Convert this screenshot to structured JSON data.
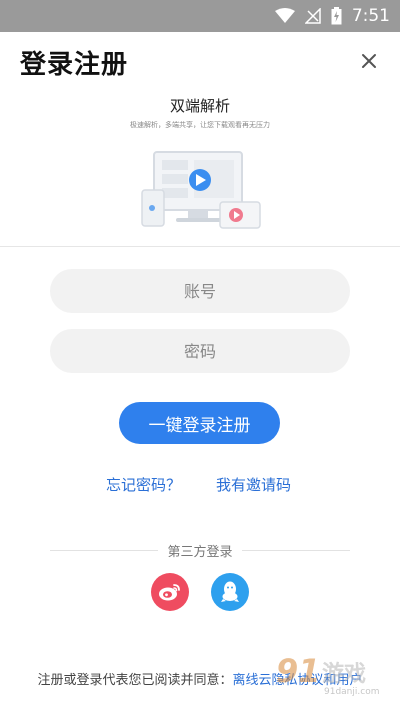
{
  "status_bar": {
    "time": "7:51"
  },
  "header": {
    "title": "登录注册"
  },
  "banner": {
    "title": "双端解析",
    "subtitle": "极速解析，多端共享，让您下载观看再无压力"
  },
  "form": {
    "account_placeholder": "账号",
    "password_placeholder": "密码",
    "submit_label": "一键登录注册"
  },
  "links": {
    "forgot_password": "忘记密码？",
    "invite_code": "我有邀请码"
  },
  "third_party": {
    "label": "第三方登录",
    "providers": [
      "weibo",
      "qq"
    ]
  },
  "footer": {
    "prefix": "注册或登录代表您已阅读并同意：",
    "agreement": "离线云隐私协议和用户"
  },
  "watermark": {
    "logo": "91",
    "text": "游戏",
    "sub": "91danji.com"
  },
  "colors": {
    "primary": "#2f80ed",
    "weibo": "#ef4c60",
    "qq": "#2ea0ee"
  }
}
